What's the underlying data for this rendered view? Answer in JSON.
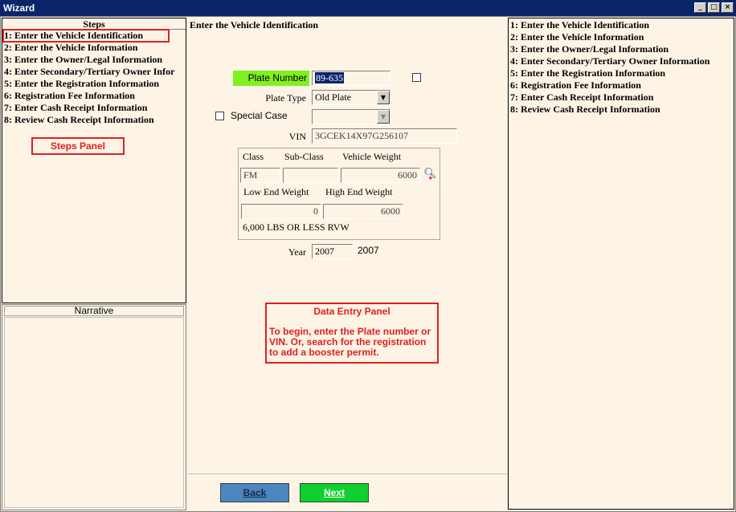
{
  "window": {
    "title": "Wizard",
    "minimize": "_",
    "maximize": "□",
    "close": "×"
  },
  "steps": {
    "header": "Steps",
    "items": [
      "1: Enter the Vehicle Identification",
      "2: Enter the Vehicle Information",
      "3: Enter the Owner/Legal Information",
      "4: Enter  Secondary/Tertiary  Owner Infor",
      "5: Enter the Registration Information",
      "6: Registration Fee Information",
      "7: Enter Cash Receipt Information",
      "8: Review Cash Receipt Information"
    ],
    "callout": "Steps Panel"
  },
  "narrative": {
    "header": "Narrative"
  },
  "form": {
    "title": "Enter the Vehicle Identification",
    "plate_number_label": "Plate Number",
    "plate_number_value": "89-635",
    "plate_type_label": "Plate Type",
    "plate_type_value": "Old Plate",
    "special_case_label": "Special Case",
    "special_case_value": "",
    "vin_label": "VIN",
    "vin_value": "3GCEK14X97G256107",
    "class_label": "Class",
    "subclass_label": "Sub-Class",
    "vehicle_weight_label": "Vehicle  Weight",
    "class_value": "FM",
    "subclass_value": "",
    "vehicle_weight_value": "6000",
    "low_end_label": "Low End Weight",
    "high_end_label": "High End Weight",
    "low_end_value": "0",
    "high_end_value": "6000",
    "weight_note": "6,000 LBS OR LESS RVW",
    "year_label": "Year",
    "year_value": "2007",
    "year_display": "2007"
  },
  "data_entry_callout": {
    "title": "Data Entry Panel",
    "text": "To begin, enter the Plate number or VIN.  Or, search for the registration to add a booster permit."
  },
  "nav": {
    "back": "Back",
    "next": "Next"
  },
  "right_steps": [
    "1: Enter the Vehicle Identification",
    "2: Enter the Vehicle Information",
    "3: Enter the Owner/Legal Information",
    "4: Enter Secondary/Tertiary Owner Information",
    "5: Enter the Registration Information",
    "6: Registration Fee Information",
    "7: Enter Cash Receipt Information",
    "8: Review Cash Receipt Information"
  ],
  "icons": {
    "search": "search-icon",
    "dropdown": "chevron-down-icon"
  }
}
